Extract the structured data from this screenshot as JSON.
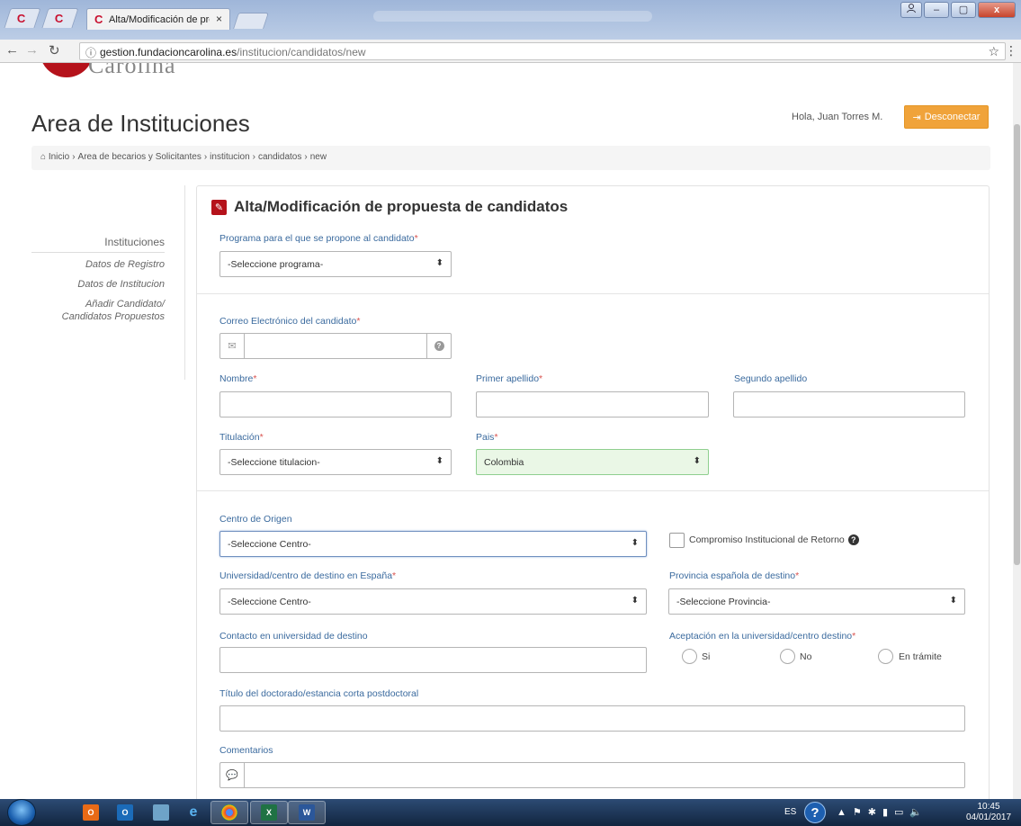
{
  "browser": {
    "tab_title": "Alta/Modificación de pro",
    "tab_close": "×",
    "favicon_letter": "C",
    "url_domain": "gestion.fundacioncarolina.es",
    "url_path": "/institucion/candidatos/new",
    "window_controls": {
      "minimize": "–",
      "maximize": "▢",
      "close": "x"
    }
  },
  "header": {
    "logo_text": "Carolina",
    "page_title": "Area de Instituciones",
    "greeting": "Hola, Juan Torres M.",
    "logout_label": "Desconectar"
  },
  "breadcrumb": [
    "Inicio",
    "Area de becarios y Solicitantes",
    "institucion",
    "candidatos",
    "new"
  ],
  "sidebar": {
    "heading": "Instituciones",
    "items": [
      {
        "label": "Datos de Registro"
      },
      {
        "label": "Datos de Institucion"
      },
      {
        "label": "Añadir Candidato/"
      },
      {
        "label": "Candidatos Propuestos"
      }
    ]
  },
  "form": {
    "title": "Alta/Modificación de propuesta de candidatos",
    "programa": {
      "label": "Programa para el que se propone al candidato",
      "value": "-Seleccione programa-"
    },
    "correo": {
      "label": "Correo Electrónico del candidato",
      "value": ""
    },
    "nombre": {
      "label": "Nombre",
      "value": ""
    },
    "primer_apellido": {
      "label": "Primer apellido",
      "value": ""
    },
    "segundo_apellido": {
      "label": "Segundo apellido",
      "value": ""
    },
    "titulacion": {
      "label": "Titulación",
      "value": "-Seleccione titulacion-"
    },
    "pais": {
      "label": "Pais",
      "value": "Colombia"
    },
    "centro_origen": {
      "label": "Centro de Origen",
      "value": "-Seleccione Centro-"
    },
    "compromiso": {
      "label": "Compromiso Institucional de Retorno"
    },
    "universidad_destino": {
      "label": "Universidad/centro de destino en España",
      "value": "-Seleccione Centro-"
    },
    "provincia": {
      "label": "Provincia española de destino",
      "value": "-Seleccione Provincia-"
    },
    "contacto": {
      "label": "Contacto en universidad de destino",
      "value": ""
    },
    "aceptacion": {
      "label": "Aceptación en la universidad/centro destino",
      "options": [
        "Si",
        "No",
        "En trámite"
      ]
    },
    "titulo_doctorado": {
      "label": "Título del doctorado/estancia corta postdoctoral",
      "value": ""
    },
    "comentarios": {
      "label": "Comentarios",
      "value": ""
    },
    "required_mark": "*"
  },
  "taskbar": {
    "apps": [
      "O",
      "O",
      "",
      "e",
      "",
      "X",
      "W"
    ],
    "language": "ES",
    "time": "10:45",
    "date": "04/01/2017"
  },
  "colors": {
    "brand_red": "#b5121b",
    "logout_orange": "#f0a33a",
    "label_blue": "#3a6a9e",
    "required_red": "#d9534f",
    "valid_green_bg": "#eaf7e6"
  }
}
